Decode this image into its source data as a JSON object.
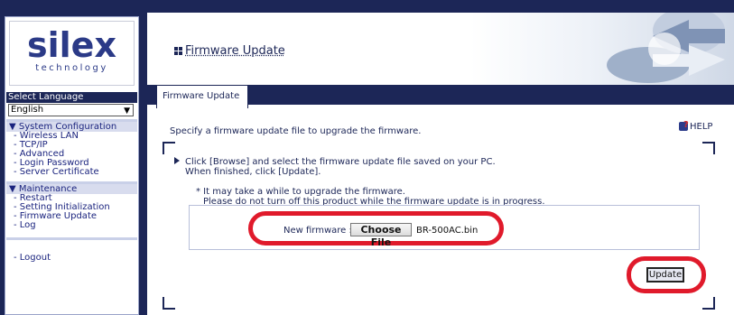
{
  "logo": {
    "main": "silex",
    "sub": "technology"
  },
  "language": {
    "label": "Select Language",
    "selected": "English"
  },
  "menu": {
    "system_configuration": {
      "title": "▼ System Configuration",
      "items": [
        "- Wireless LAN",
        "- TCP/IP",
        "- Advanced",
        "- Login Password",
        "- Server Certificate"
      ]
    },
    "maintenance": {
      "title": "▼ Maintenance",
      "items": [
        "- Restart",
        "- Setting Initialization",
        "- Firmware Update",
        "- Log"
      ]
    },
    "logout": "- Logout"
  },
  "page": {
    "title": "Firmware Update",
    "tab": "Firmware Update",
    "description": "Specify a firmware update file to upgrade the firmware.",
    "help": "HELP",
    "instruction_line1": "Click [Browse] and select the firmware update file saved on your PC.",
    "instruction_line2": "When finished, click [Update].",
    "note_line1": "* It may take a while to upgrade the firmware.",
    "note_line2": "Please do not turn off this product while the firmware update is in progress.",
    "new_firmware_label": "New firmware :",
    "choose_button": "Choose File",
    "file_name": "BR-500AC.bin",
    "update_button": "Update"
  },
  "colors": {
    "navy": "#1c2657",
    "highlight_red": "#e01a2b"
  }
}
